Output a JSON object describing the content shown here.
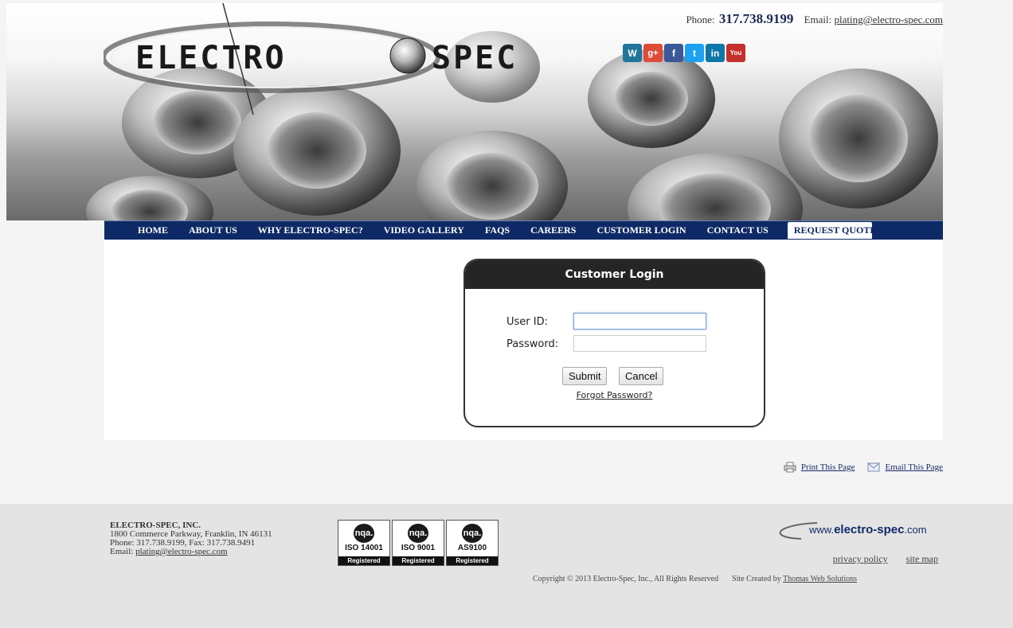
{
  "header": {
    "phone_label": "Phone:",
    "phone_number": "317.738.9199",
    "email_label": "Email:",
    "email": "plating@electro-spec.com",
    "logo_text": "ELECTRO SPEC",
    "social": [
      {
        "icon": "wordpress-icon",
        "glyph": "W",
        "color": "#21759b"
      },
      {
        "icon": "google-plus-icon",
        "glyph": "g+",
        "color": "#dd4b39"
      },
      {
        "icon": "facebook-icon",
        "glyph": "f",
        "color": "#3b5998"
      },
      {
        "icon": "twitter-icon",
        "glyph": "t",
        "color": "#1da1f2"
      },
      {
        "icon": "linkedin-icon",
        "glyph": "in",
        "color": "#0e76a8"
      },
      {
        "icon": "youtube-icon",
        "glyph": "You",
        "color": "#c4302b"
      }
    ]
  },
  "nav": {
    "items": [
      "HOME",
      "ABOUT US",
      "WHY ELECTRO-SPEC?",
      "VIDEO GALLERY",
      "FAQS",
      "CAREERS",
      "CUSTOMER LOGIN",
      "CONTACT US",
      "REQUEST QUOTE"
    ]
  },
  "login": {
    "title": "Customer Login",
    "user_label": "User ID:",
    "user_value": "",
    "password_label": "Password:",
    "password_value": "",
    "submit": "Submit",
    "cancel": "Cancel",
    "forgot": "Forgot Password?"
  },
  "page_tools": {
    "print": "Print This Page",
    "email": "Email This Page"
  },
  "footer": {
    "company": "ELECTRO-SPEC, INC.",
    "address": "1800 Commerce Parkway, Franklin, IN 46131",
    "phone_fax": "Phone: 317.738.9199, Fax: 317.738.9491",
    "email_label": "Email:",
    "email": "plating@electro-spec.com",
    "badges": [
      {
        "brand": "nqa.",
        "standard": "ISO 14001",
        "status": "Registered"
      },
      {
        "brand": "nqa.",
        "standard": "ISO 9001",
        "status": "Registered"
      },
      {
        "brand": "nqa.",
        "standard": "AS9100",
        "status": "Registered"
      }
    ],
    "www_prefix": "www.",
    "www_domain": "electro-spec",
    "www_suffix": ".com",
    "privacy": "privacy policy",
    "sitemap": "site map",
    "copyright": "Copyright © 2013 Electro-Spec, Inc., All Rights Reserved",
    "credit_prefix": "Site Created by",
    "credit_link": "Thomas Web Solutions"
  },
  "colors": {
    "nav_bg": "#0e2a66",
    "login_header": "#252525",
    "page_bg": "#f4f4f4"
  }
}
